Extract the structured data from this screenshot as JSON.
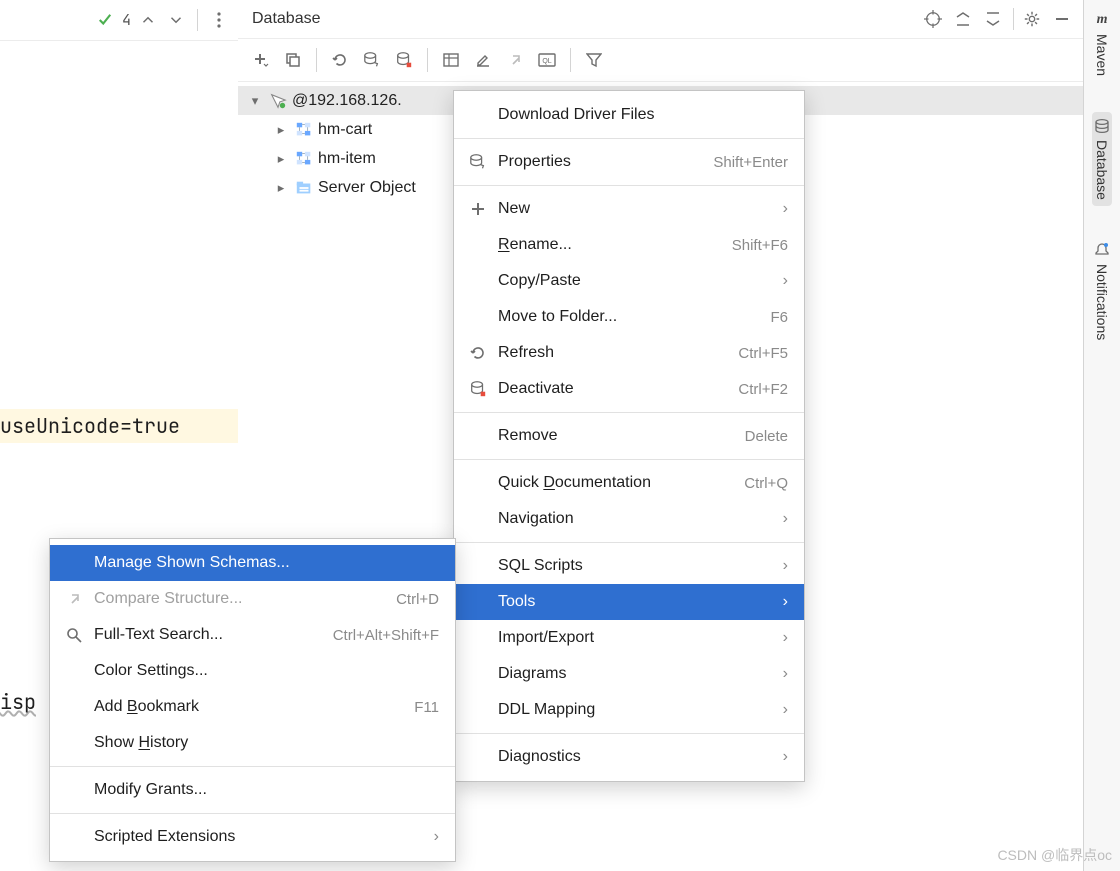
{
  "editor": {
    "checks_count": "4",
    "line1": "useUnicode=true",
    "line2": "isp"
  },
  "db": {
    "title": "Database",
    "tree": {
      "root": "@192.168.126.",
      "items": [
        "hm-cart",
        "hm-item",
        "Server Object"
      ]
    }
  },
  "ctx_main": {
    "download": "Download Driver Files",
    "properties": "Properties",
    "properties_sc": "Shift+Enter",
    "new": "New",
    "rename_pre": "R",
    "rename_post": "ename...",
    "rename_sc": "Shift+F6",
    "copypaste": "Copy/Paste",
    "move": "Move to Folder...",
    "move_sc": "F6",
    "refresh": "Refresh",
    "refresh_sc": "Ctrl+F5",
    "deactivate": "Deactivate",
    "deactivate_sc": "Ctrl+F2",
    "remove": "Remove",
    "remove_sc": "Delete",
    "quickdoc_pre": "Quick ",
    "quickdoc_u": "D",
    "quickdoc_post": "ocumentation",
    "quickdoc_sc": "Ctrl+Q",
    "navigation": "Navigation",
    "sqlscripts": "SQL Scripts",
    "tools": "Tools",
    "importexport": "Import/Export",
    "diagrams": "Diagrams",
    "ddl": "DDL Mapping",
    "diagnostics": "Diagnostics"
  },
  "ctx_sub": {
    "manage": "Manage Shown Schemas...",
    "compare": "Compare Structure...",
    "compare_sc": "Ctrl+D",
    "fts": "Full-Text Search...",
    "fts_sc": "Ctrl+Alt+Shift+F",
    "color": "Color Settings...",
    "bookmark_pre": "Add ",
    "bookmark_u": "B",
    "bookmark_post": "ookmark",
    "bookmark_sc": "F11",
    "history_pre": "Show ",
    "history_u": "H",
    "history_post": "istory",
    "grants": "Modify Grants...",
    "scripted": "Scripted Extensions"
  },
  "stripe": {
    "maven": "Maven",
    "database": "Database",
    "notifications": "Notifications"
  },
  "watermark": "CSDN @临界点oc"
}
